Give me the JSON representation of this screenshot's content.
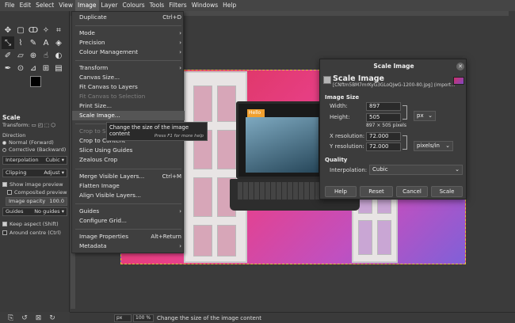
{
  "menubar": [
    "File",
    "Edit",
    "Select",
    "View",
    "Image",
    "Layer",
    "Colours",
    "Tools",
    "Filters",
    "Windows",
    "Help"
  ],
  "image_menu": {
    "duplicate": "Duplicate",
    "duplicate_sc": "Ctrl+D",
    "mode": "Mode",
    "precision": "Precision",
    "colour_mgmt": "Colour Management",
    "transform": "Transform",
    "canvas_size": "Canvas Size...",
    "fit_layers": "Fit Canvas to Layers",
    "fit_selection": "Fit Canvas to Selection",
    "print_size": "Print Size...",
    "scale_image": "Scale Image...",
    "crop_sel": "Crop to Selection",
    "crop_content": "Crop to Content",
    "slice_guides": "Slice Using Guides",
    "zealous": "Zealous Crop",
    "merge": "Merge Visible Layers...",
    "merge_sc": "Ctrl+M",
    "flatten": "Flatten Image",
    "align": "Align Visible Layers...",
    "guides": "Guides",
    "configure_grid": "Configure Grid...",
    "properties": "Image Properties",
    "properties_sc": "Alt+Return",
    "metadata": "Metadata"
  },
  "tooltip": {
    "text": "Change the size of the image content",
    "hint": "Press F1 for more help"
  },
  "tool_options": {
    "title": "Scale",
    "transform_label": "Transform:",
    "direction_label": "Direction",
    "normal": "Normal (Forward)",
    "corrective": "Corrective (Backward)",
    "interpolation_label": "Interpolation",
    "interpolation_value": "Cubic",
    "clipping_label": "Clipping",
    "clipping_value": "Adjust",
    "show_preview": "Show image preview",
    "composited_preview": "Composited preview",
    "opacity_label": "Image opacity",
    "opacity_value": "100.0",
    "guides_label": "Guides",
    "guides_value": "No guides",
    "keep_aspect": "Keep aspect (Shift)",
    "around_centre": "Around centre (Ctrl)"
  },
  "canvas_overlay": {
    "hello": "Hello"
  },
  "dialog": {
    "title": "Scale Image",
    "heading": "Scale Image",
    "file": "[CNftm5BM7mrKyG3GLoQjwG-1200-80.jpg] (import...",
    "image_size_label": "Image Size",
    "width_label": "Width:",
    "width": "897",
    "height_label": "Height:",
    "height": "505",
    "unit": "px",
    "pixels_info": "897 × 505 pixels",
    "xres_label": "X resolution:",
    "xres": "72.000",
    "yres_label": "Y resolution:",
    "yres": "72.000",
    "res_unit": "pixels/in",
    "quality_label": "Quality",
    "interp_label": "Interpolation:",
    "interp": "Cubic",
    "help": "Help",
    "reset": "Reset",
    "cancel": "Cancel",
    "scale": "Scale"
  },
  "statusbar": {
    "unit": "px",
    "zoom": "100 %",
    "text": "Change the size of the image content"
  }
}
